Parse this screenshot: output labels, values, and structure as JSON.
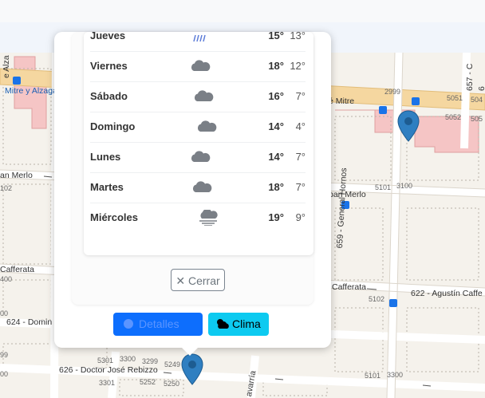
{
  "forecast": [
    {
      "day": "Jueves",
      "high": "15°",
      "low": "13°",
      "icon": "rain-icon"
    },
    {
      "day": "Viernes",
      "high": "18°",
      "low": "12°",
      "icon": "cloud-icon"
    },
    {
      "day": "Sábado",
      "high": "16°",
      "low": "7°",
      "icon": "cloud-icon"
    },
    {
      "day": "Domingo",
      "high": "14°",
      "low": "4°",
      "icon": "cloud-icon"
    },
    {
      "day": "Lunes",
      "high": "14°",
      "low": "7°",
      "icon": "cloud-icon"
    },
    {
      "day": "Martes",
      "high": "18°",
      "low": "7°",
      "icon": "cloud-icon"
    },
    {
      "day": "Miércoles",
      "high": "19°",
      "low": "9°",
      "icon": "fog-icon"
    }
  ],
  "buttons": {
    "close": "Cerrar",
    "close_symbol": "✕",
    "details": "Detalles",
    "clima": "Clima"
  },
  "map": {
    "streets": {
      "mitre_left": "Mitre y Alzaga",
      "mitre_right": "é Mitre",
      "merlo_left": "an Merlo",
      "merlo_right": "pan Merlo",
      "cafferata_left": "Cafferata",
      "cafferata_right": "Cafferata",
      "dominguez": "624 - Domin",
      "rebizzo": "626 - Doctor José Rebizzo",
      "general_hornos": "659 - General Hornos",
      "agustin": "622 - Agustín Caffe",
      "navarria": "avarría",
      "alza": "e Alza",
      "s657": "657 - C",
      "s6": "6"
    },
    "numbers": {
      "n2999": "2999",
      "n5051": "5051",
      "n504": "504",
      "n5052": "5052",
      "n5050": "505",
      "n5101a": "5101",
      "n3100a": "3100",
      "n102": "102",
      "n5102": "5102",
      "n400": "400",
      "n00": "00",
      "n99": "99",
      "n5301": "5301",
      "n3300a": "3300",
      "n3299": "3299",
      "n5249": "5249",
      "n5252": "5252",
      "n5250": "5250",
      "n3301": "3301",
      "n5101b": "5101",
      "n3300b": "3300",
      "n00b": "00"
    }
  },
  "colors": {
    "primary": "#0d6efd",
    "info": "#0dcaf0",
    "pin": "#2f7fc1",
    "mitre": "#f5d7a0",
    "block": "#f5c5c5"
  }
}
